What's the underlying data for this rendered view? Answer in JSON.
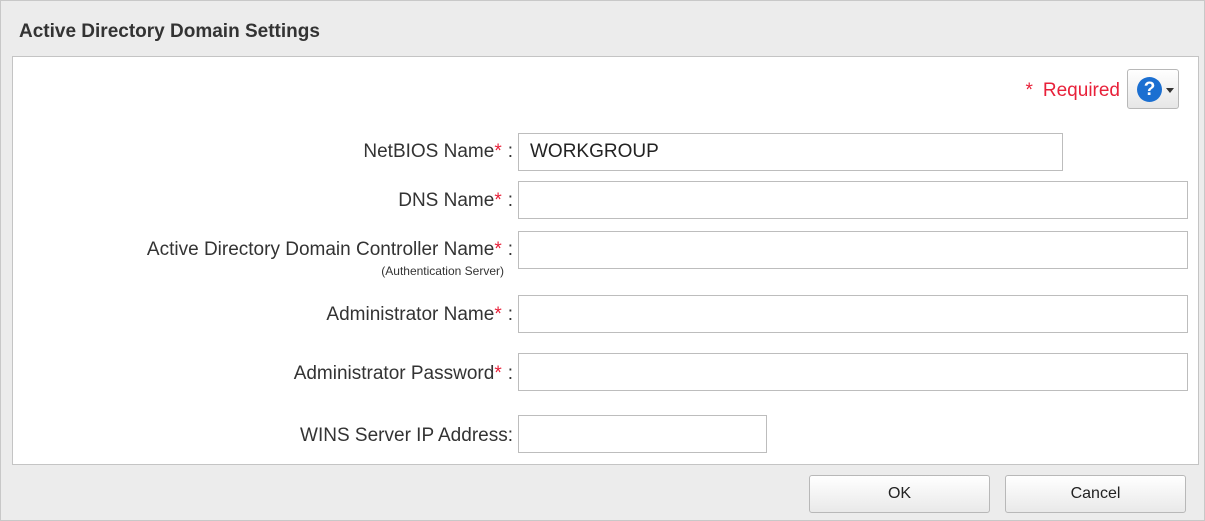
{
  "dialog": {
    "title": "Active Directory Domain Settings",
    "required_star": "*",
    "required_label": "Required",
    "help_glyph": "?",
    "colors": {
      "required": "#e8213a",
      "help": "#1b6fd1"
    }
  },
  "form": {
    "netbios": {
      "label": "NetBIOS Name",
      "value": "WORKGROUP"
    },
    "dns": {
      "label": "DNS Name",
      "value": ""
    },
    "ad_controller": {
      "label": "Active Directory Domain Controller Name",
      "sublabel": "(Authentication Server)",
      "value": ""
    },
    "admin_name": {
      "label": "Administrator Name",
      "value": ""
    },
    "admin_password": {
      "label": "Administrator Password",
      "value": ""
    },
    "wins": {
      "label": "WINS Server IP Address:",
      "value": ""
    },
    "star": "*",
    "colon": ":"
  },
  "buttons": {
    "ok": "OK",
    "cancel": "Cancel"
  }
}
